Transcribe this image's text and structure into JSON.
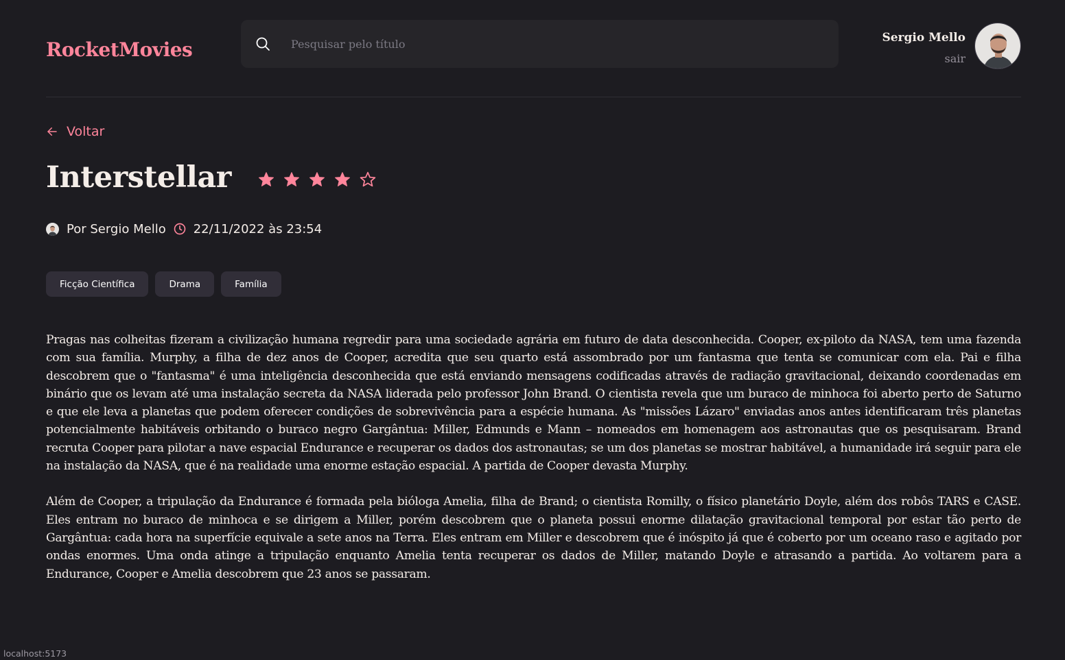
{
  "header": {
    "brand": "RocketMovies",
    "search_placeholder": "Pesquisar pelo título",
    "search_value": "",
    "profile": {
      "name": "Sergio Mello",
      "logout_label": "sair"
    }
  },
  "movie": {
    "back_label": "Voltar",
    "title": "Interstellar",
    "rating": 4,
    "rating_max": 5,
    "author": "Por Sergio Mello",
    "datetime": "22/11/2022 às 23:54",
    "tags": [
      "Ficção Científica",
      "Drama",
      "Família"
    ],
    "description": [
      "Pragas nas colheitas fizeram a civilização humana regredir para uma sociedade agrária em futuro de data desconhecida. Cooper, ex-piloto da NASA, tem uma fazenda com sua família. Murphy, a filha de dez anos de Cooper, acredita que seu quarto está assombrado por um fantasma que tenta se comunicar com ela. Pai e filha descobrem que o \"fantasma\" é uma inteligência desconhecida que está enviando mensagens codificadas através de radiação gravitacional, deixando coordenadas em binário que os levam até uma instalação secreta da NASA liderada pelo professor John Brand. O cientista revela que um buraco de minhoca foi aberto perto de Saturno e que ele leva a planetas que podem oferecer condições de sobrevivência para a espécie humana. As \"missões Lázaro\" enviadas anos antes identificaram três planetas potencialmente habitáveis orbitando o buraco negro Gargântua: Miller, Edmunds e Mann – nomeados em homenagem aos astronautas que os pesquisaram. Brand recruta Cooper para pilotar a nave espacial Endurance e recuperar os dados dos astronautas; se um dos planetas se mostrar habitável, a humanidade irá seguir para ele na instalação da NASA, que é na realidade uma enorme estação espacial. A partida de Cooper devasta Murphy.",
      "Além de Cooper, a tripulação da Endurance é formada pela bióloga Amelia, filha de Brand; o cientista Romilly, o físico planetário Doyle, além dos robôs TARS e CASE. Eles entram no buraco de minhoca e se dirigem a Miller, porém descobrem que o planeta possui enorme dilatação gravitacional temporal por estar tão perto de Gargântua: cada hora na superfície equivale a sete anos na Terra. Eles entram em Miller e descobrem que é inóspito já que é coberto por um oceano raso e agitado por ondas enormes. Uma onda atinge a tripulação enquanto Amelia tenta recuperar os dados de Miller, matando Doyle e atrasando a partida. Ao voltarem para a Endurance, Cooper e Amelia descobrem que 23 anos se passaram."
    ]
  },
  "statusbar": {
    "url": "localhost:5173"
  },
  "colors": {
    "background": "#1d1c21",
    "accent": "#ff859b",
    "input_bg": "#262529",
    "tag_bg": "#312e38",
    "text": "#f4ede8"
  },
  "icons": {
    "search": "search-icon",
    "back": "arrow-left-icon",
    "star_filled": "star-filled-icon",
    "star_empty": "star-outline-icon",
    "clock": "clock-icon"
  }
}
